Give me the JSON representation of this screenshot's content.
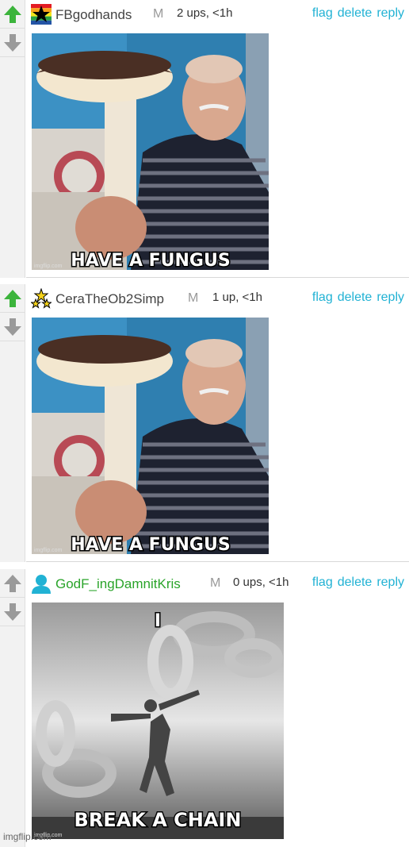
{
  "comments": [
    {
      "username": "FBgodhands",
      "mod_marker": "M",
      "meta": "2 ups, <1h",
      "actions": {
        "flag": "flag",
        "delete": "delete",
        "reply": "reply"
      },
      "upvoted": true,
      "image_caption": "HAVE A FUNGUS",
      "image_watermark": "imgflip.com"
    },
    {
      "username": "CeraTheOb2Simp",
      "mod_marker": "M",
      "meta": "1 up, <1h",
      "actions": {
        "flag": "flag",
        "delete": "delete",
        "reply": "reply"
      },
      "upvoted": true,
      "image_caption": "HAVE A FUNGUS",
      "image_watermark": "imgflip.com"
    },
    {
      "username": "GodF_ingDamnitKris",
      "mod_marker": "M",
      "meta": "0 ups, <1h",
      "actions": {
        "flag": "flag",
        "delete": "delete",
        "reply": "reply"
      },
      "upvoted": false,
      "image_caption_top": "I",
      "image_caption": "BREAK A CHAIN",
      "image_watermark": "imgflip.com"
    }
  ],
  "site_watermark": "imgflip.com",
  "colors": {
    "upvote_active": "#3cb43c",
    "vote_inactive": "#9a9a9a",
    "link": "#21b2d4",
    "green_user": "#2aa42a"
  }
}
